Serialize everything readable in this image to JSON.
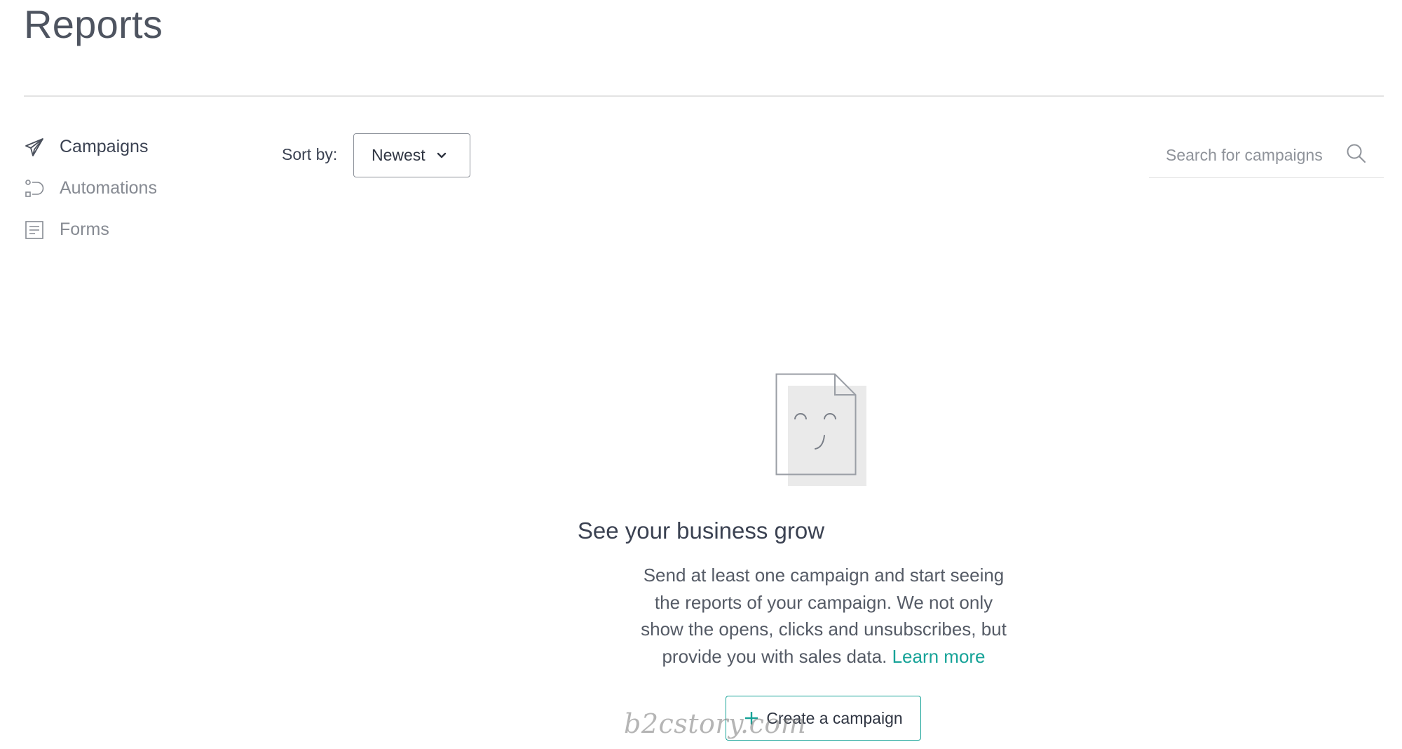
{
  "page": {
    "title": "Reports"
  },
  "sidebar": {
    "items": [
      {
        "label": "Campaigns",
        "icon": "paper-plane-icon",
        "active": true
      },
      {
        "label": "Automations",
        "icon": "workflow-icon",
        "active": false
      },
      {
        "label": "Forms",
        "icon": "form-icon",
        "active": false
      }
    ]
  },
  "toolbar": {
    "sort_label": "Sort by:",
    "sort_value": "Newest",
    "search_placeholder": "Search for campaigns"
  },
  "empty_state": {
    "illustration": "smiling-document-icon",
    "title": "See your business grow",
    "description": "Send at least one campaign and start seeing the reports of your campaign. We not only show the opens, clicks and unsubscribes, but provide you with sales data.",
    "learn_more": "Learn more",
    "button_label": "Create a campaign"
  },
  "watermark": "b2cstory.com",
  "colors": {
    "accent": "#17a398",
    "text_dark": "#3b4252",
    "text_muted": "#868a92"
  }
}
